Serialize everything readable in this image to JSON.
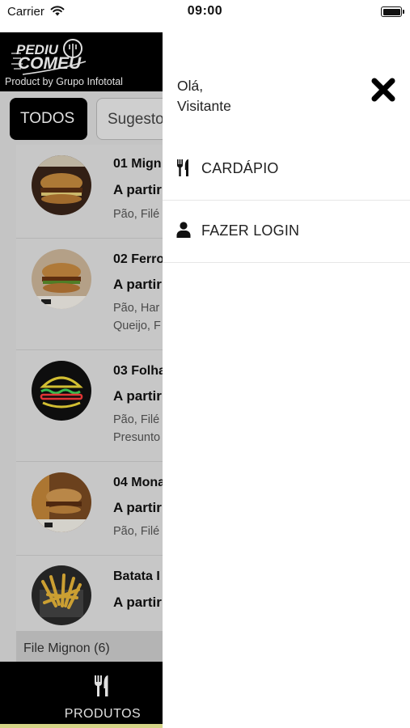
{
  "status_bar": {
    "carrier": "Carrier",
    "time": "09:00"
  },
  "app": {
    "logo": {
      "line1": "PEDIU",
      "line2": "COMEU",
      "subtitle": "Product by Grupo Infototal"
    },
    "filters": [
      {
        "label": "TODOS",
        "selected": true
      },
      {
        "label": "Sugesto",
        "selected": false
      }
    ],
    "products": [
      {
        "name": "01 Mign",
        "price": "A partir",
        "desc": [
          "Pão, Filé"
        ]
      },
      {
        "name": "02 Ferro",
        "price": "A partir",
        "desc": [
          "Pão, Har",
          "Queijo, F"
        ]
      },
      {
        "name": "03 Folha",
        "price": "A partir",
        "desc": [
          "Pão, Filé",
          "Presunto"
        ]
      },
      {
        "name": "04 Mona",
        "price": "A partir",
        "desc": [
          "Pão, Filé"
        ]
      },
      {
        "name": "Batata I",
        "price": "A partir",
        "desc": []
      }
    ],
    "section_label": "File Mignon (6)",
    "tabbar": {
      "label": "PRODUTOS"
    }
  },
  "drawer": {
    "greeting_line1": "Olá,",
    "greeting_line2": "Visitante",
    "menu": [
      {
        "label": "CARDÁPIO",
        "icon": "fork-knife-icon"
      },
      {
        "label": "FAZER LOGIN",
        "icon": "user-icon"
      }
    ]
  },
  "colors": {
    "header_bg": "#000000",
    "tab_strip": "#f2f29a",
    "drawer_bg": "#ffffff"
  }
}
